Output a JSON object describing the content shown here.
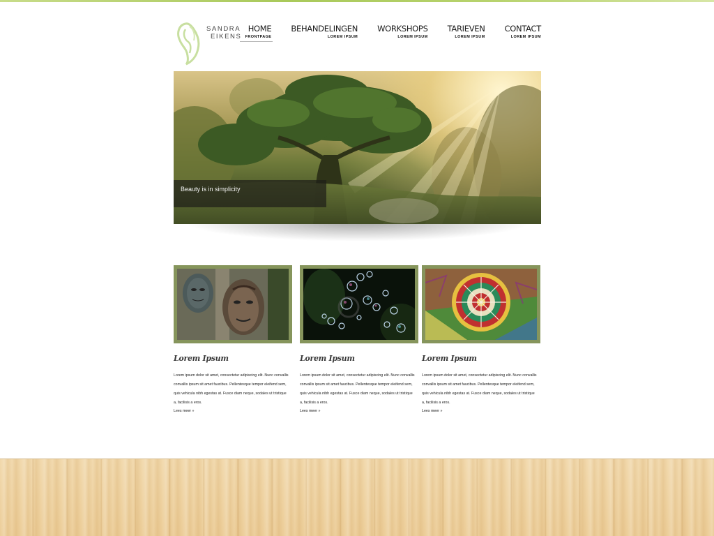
{
  "brand": {
    "line1": "SANDRA",
    "line2": "EIKENS",
    "accent": "#c8dc8a",
    "frame_color": "#86955c"
  },
  "nav": {
    "items": [
      {
        "label": "HOME",
        "sub": "FRONTPAGE",
        "active": true
      },
      {
        "label": "BEHANDELINGEN",
        "sub": "LOREM IPSUM"
      },
      {
        "label": "WORKSHOPS",
        "sub": "LOREM IPSUM"
      },
      {
        "label": "TARIEVEN",
        "sub": "LOREM IPSUM"
      },
      {
        "label": "CONTACT",
        "sub": "LOREM IPSUM"
      }
    ]
  },
  "hero": {
    "caption": "Beauty is in simplicity"
  },
  "columns": [
    {
      "image": "carved-faces",
      "title": "Lorem Ipsum",
      "text": "Lorem ipsum dolor sit amet, consectetur adipiscing elit. Nunc convallis convallis ipsum sit amet faucibus. Pellentesque tempor eleifend sem, quis vehicula nibh egestas at. Fusce diam neque, sodales ut tristique a, facilisis a eros.",
      "more": "Lees meer »"
    },
    {
      "image": "soap-bubbles",
      "title": "Lorem Ipsum",
      "text": "Lorem ipsum dolor sit amet, consectetur adipiscing elit. Nunc convallis convallis ipsum sit amet faucibus. Pellentesque tempor eleifend sem, quis vehicula nibh egestas at. Fusce diam neque, sodales ut tristique a, facilisis a eros.",
      "more": "Lees meer »"
    },
    {
      "image": "sand-mandala",
      "title": "Lorem Ipsum",
      "text": "Lorem ipsum dolor sit amet, consectetur adipiscing elit. Nunc convallis convallis ipsum sit amet faucibus. Pellentesque tempor eleifend sem, quis vehicula nibh egestas at. Fusce diam neque, sodales ut tristique a, facilisis a eros.",
      "more": "Lees meer »"
    }
  ]
}
